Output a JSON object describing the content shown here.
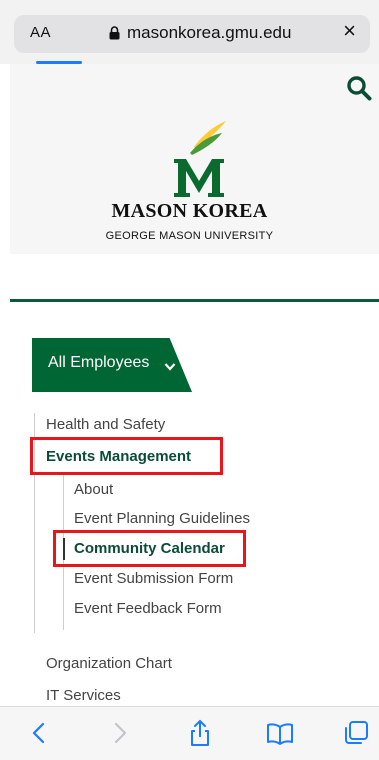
{
  "browser": {
    "aa_label": "AA",
    "url": "masonkorea.gmu.edu",
    "close": "×"
  },
  "header": {
    "brand_title": "MASON KOREA",
    "brand_subtitle": "GEORGE MASON UNIVERSITY"
  },
  "menu": {
    "dropdown_label": "All Employees"
  },
  "nav": {
    "items": [
      {
        "label": "Health and Safety"
      },
      {
        "label": "Events Management"
      },
      {
        "label": "Organization Chart"
      },
      {
        "label": "IT Services"
      }
    ],
    "sub_items": [
      {
        "label": "About"
      },
      {
        "label": "Event Planning Guidelines"
      },
      {
        "label": "Community Calendar"
      },
      {
        "label": "Event Submission Form"
      },
      {
        "label": "Event Feedback Form"
      }
    ]
  },
  "colors": {
    "mason_green": "#006633",
    "mason_gold": "#FFCC33",
    "highlight_red": "#E8151B",
    "safari_blue": "#1D7BFF"
  }
}
